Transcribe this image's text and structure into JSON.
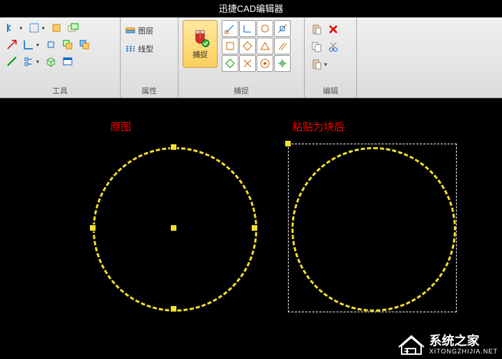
{
  "app": {
    "title": "迅捷CAD编辑器"
  },
  "ribbon": {
    "groups": {
      "tools": {
        "label": "工具"
      },
      "attrs": {
        "label": "属性",
        "layer": "图层",
        "linetype": "线型"
      },
      "snap": {
        "label": "捕捉",
        "button": "捕捉"
      },
      "edit": {
        "label": "编辑"
      }
    }
  },
  "canvas": {
    "label_left": "原图",
    "label_right": "粘贴为块后"
  },
  "watermark": {
    "name": "系统之家",
    "url": "XITONGZHIJIA.NET"
  }
}
